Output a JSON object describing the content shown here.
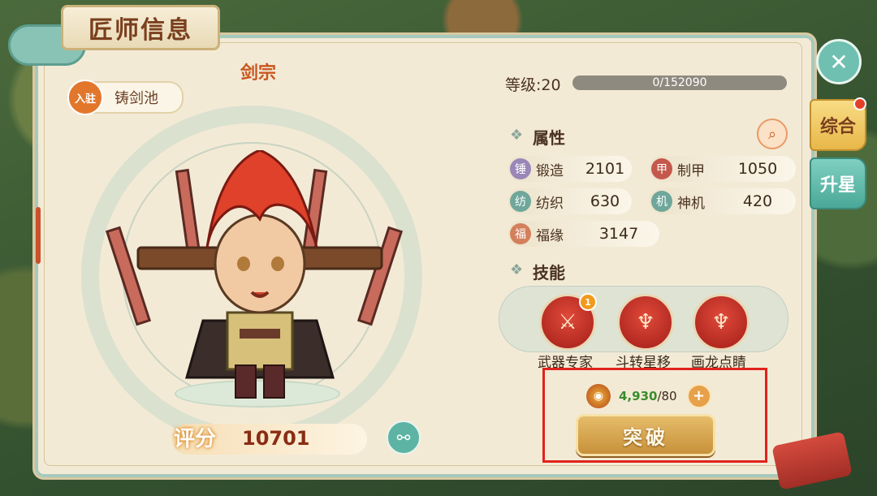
{
  "title": "匠师信息",
  "tabs": [
    {
      "label": "综合",
      "has_dot": true
    },
    {
      "label": "升星",
      "has_dot": false
    }
  ],
  "character": {
    "name": "剑宗",
    "station_badge": "入驻",
    "station": "铸剑池",
    "score_label": "评分",
    "score": "10701"
  },
  "level": {
    "label": "等级:20",
    "progress_text": "0/152090",
    "progress_fraction": 0
  },
  "attributes_title": "属性",
  "attributes": [
    {
      "name": "锻造",
      "value": "2101",
      "icon": "anvil-icon",
      "color": "#9a87b8"
    },
    {
      "name": "制甲",
      "value": "1050",
      "icon": "armor-icon",
      "color": "#c5584c"
    },
    {
      "name": "纺织",
      "value": "630",
      "icon": "thread-icon",
      "color": "#6fa79a"
    },
    {
      "name": "神机",
      "value": "420",
      "icon": "gear-icon",
      "color": "#6fa79a"
    },
    {
      "name": "福缘",
      "value": "3147",
      "icon": "fortune-icon",
      "color": "#d47f5c"
    }
  ],
  "skills_title": "技能",
  "skills": [
    {
      "name": "武器专家",
      "badge": "1"
    },
    {
      "name": "斗转星移",
      "badge": ""
    },
    {
      "name": "画龙点睛",
      "badge": ""
    }
  ],
  "breakthrough": {
    "have": "4,930",
    "need": "/80",
    "button_label": "突破"
  },
  "colors": {
    "accent_orange": "#e2772c",
    "panel": "#f3ead6",
    "teal": "#5db3a4",
    "highlight_box": "#e0231b"
  }
}
